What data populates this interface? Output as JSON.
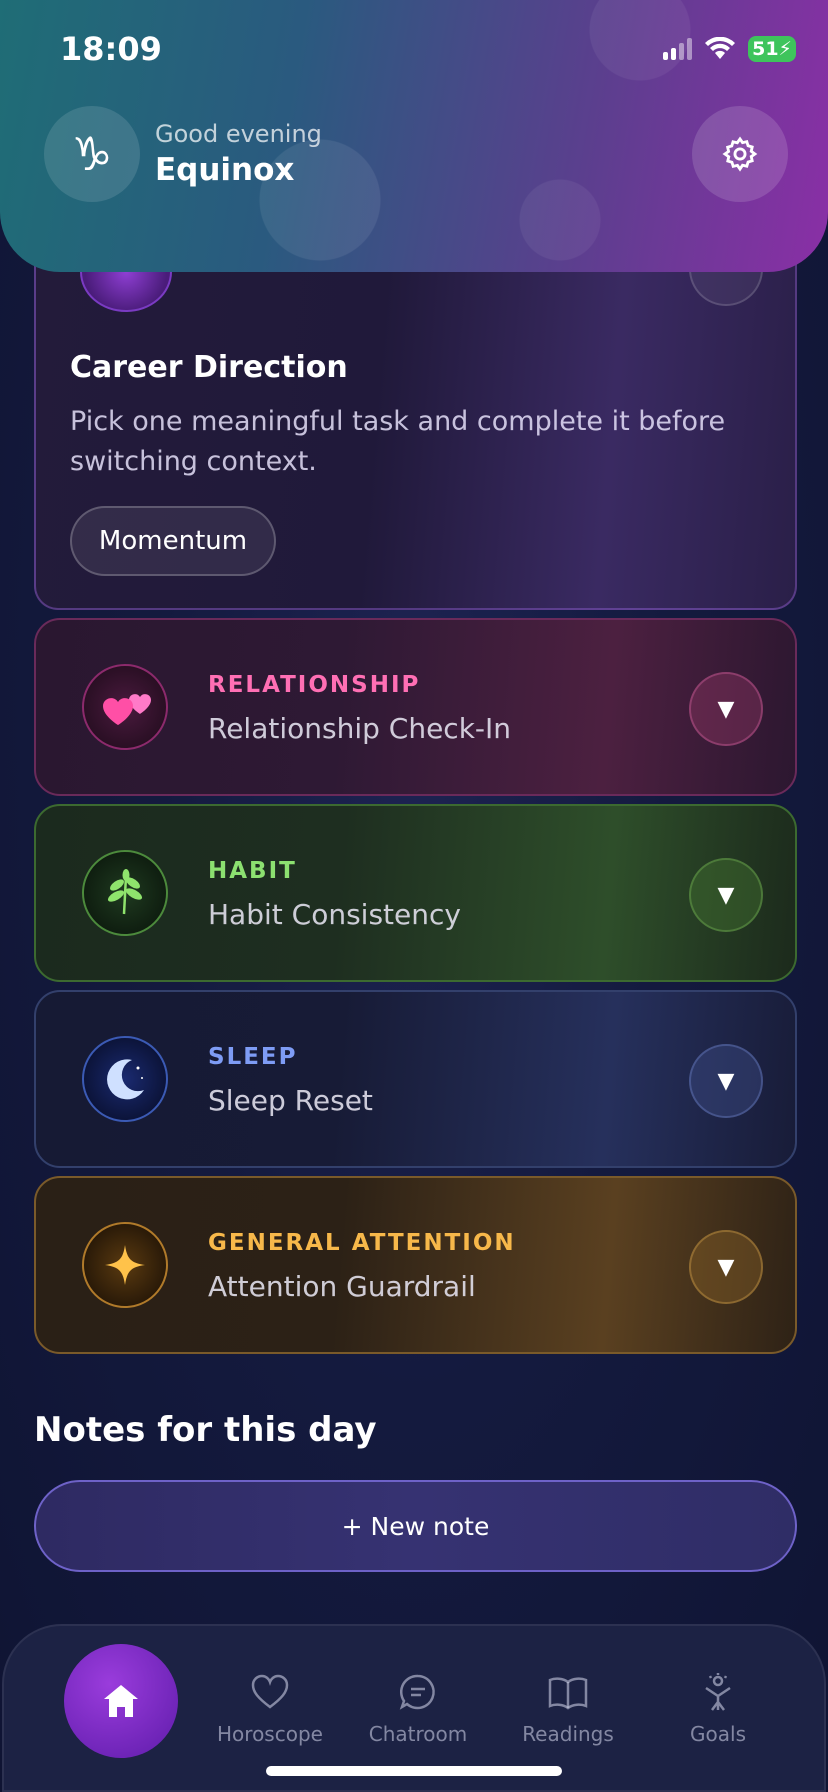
{
  "status": {
    "time": "18:09",
    "battery": "51"
  },
  "header": {
    "greeting": "Good evening",
    "username": "Equinox",
    "zodiac_glyph": "♑"
  },
  "expanded_card": {
    "title": "Career Direction",
    "description": "Pick one meaningful task and complete it before switching context.",
    "tag": "Momentum"
  },
  "categories": [
    {
      "label": "RELATIONSHIP",
      "title": "Relationship Check-In",
      "icon": "hearts-icon"
    },
    {
      "label": "HABIT",
      "title": "Habit Consistency",
      "icon": "leaf-icon"
    },
    {
      "label": "SLEEP",
      "title": "Sleep Reset",
      "icon": "moon-icon"
    },
    {
      "label": "GENERAL ATTENTION",
      "title": "Attention Guardrail",
      "icon": "sparkle-icon"
    }
  ],
  "notes": {
    "title": "Notes for this day",
    "new_note": "+ New note"
  },
  "tabs": [
    {
      "label": "Horoscope"
    },
    {
      "label": "Chatroom"
    },
    {
      "label": "Readings"
    },
    {
      "label": "Goals"
    }
  ],
  "colors": {
    "relationship": "#ff6fb4",
    "habit": "#8ce070",
    "sleep": "#7e9cf5",
    "general": "#f7b84a",
    "accent": "#8a2fa6"
  }
}
